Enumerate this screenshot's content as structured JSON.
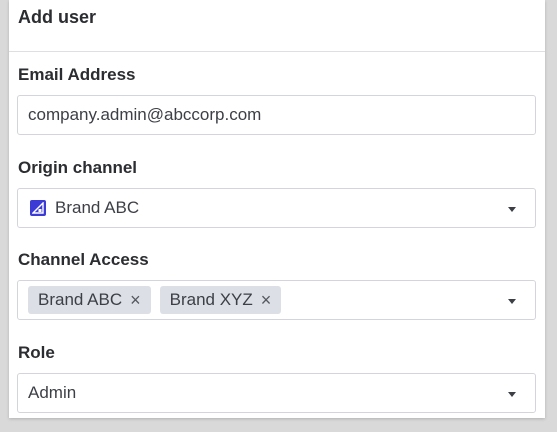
{
  "dialog": {
    "title": "Add user"
  },
  "email": {
    "label": "Email Address",
    "value": "company.admin@abccorp.com"
  },
  "origin": {
    "label": "Origin channel",
    "value": "Brand ABC",
    "icon": "brand-logo-icon",
    "icon_color": "#3d3bd6"
  },
  "access": {
    "label": "Channel Access",
    "chips": [
      {
        "label": "Brand ABC",
        "remove": "×"
      },
      {
        "label": "Brand XYZ",
        "remove": "×"
      }
    ]
  },
  "role": {
    "label": "Role",
    "value": "Admin"
  }
}
